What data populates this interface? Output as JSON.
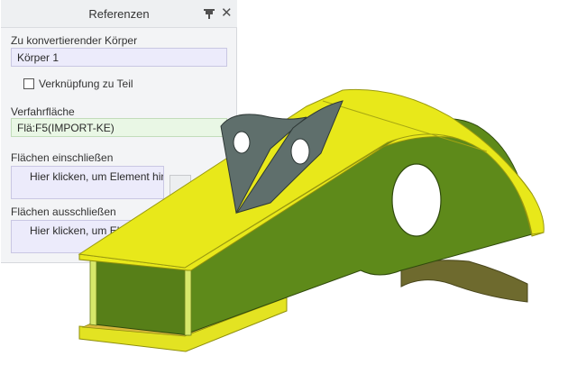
{
  "panel": {
    "title": "Referenzen",
    "body_label": "Zu konvertierender Körper",
    "body_value": "Körper 1",
    "link_checkbox_label": "Verknüpfung zu Teil",
    "link_checked": false,
    "surface_label": "Verfahrfläche",
    "surface_value": "Flä:F5(IMPORT-KE)",
    "include_label": "Flächen einschließen",
    "include_placeholder": "Hier klicken, um Element hin",
    "exclude_label": "Flächen ausschließen",
    "exclude_placeholder": "Hier klicken, um El"
  },
  "icons": {
    "pin": "pin-icon",
    "close": "close-icon"
  },
  "colors": {
    "part_top": "#e8e81a",
    "part_side": "#5e8a1a",
    "part_inner": "#567f18",
    "part_edge": "#a0a010",
    "gusset": "#5f6f6c",
    "field_purple": "#ecebfb",
    "field_green": "#e9f7e5"
  }
}
